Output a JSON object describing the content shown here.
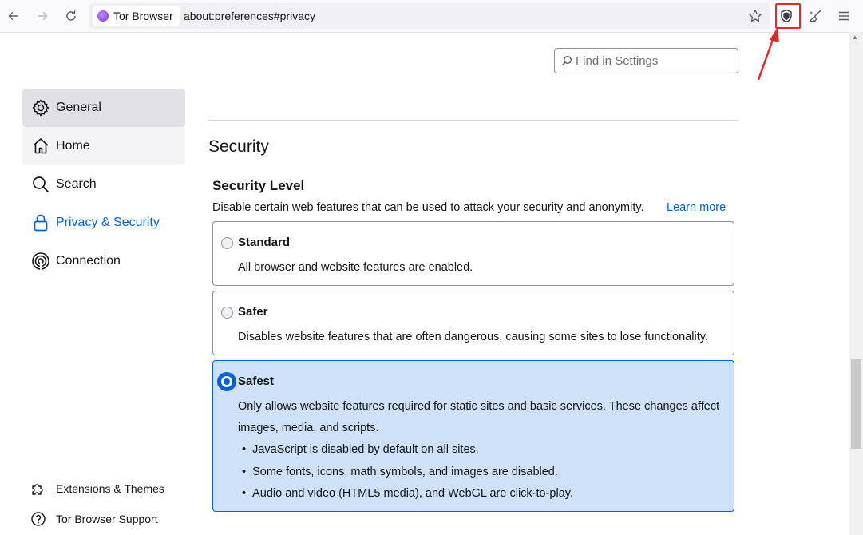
{
  "browser": {
    "identity_label": "Tor Browser",
    "url": "about:preferences#privacy"
  },
  "search": {
    "placeholder": "Find in Settings"
  },
  "sidebar": {
    "items": [
      {
        "label": "General"
      },
      {
        "label": "Home"
      },
      {
        "label": "Search"
      },
      {
        "label": "Privacy & Security"
      },
      {
        "label": "Connection"
      }
    ],
    "footer": [
      {
        "label": "Extensions & Themes"
      },
      {
        "label": "Tor Browser Support"
      }
    ]
  },
  "content": {
    "section_title": "Security",
    "level_title": "Security Level",
    "level_desc": "Disable certain web features that can be used to attack your security and anonymity.",
    "learn_more": "Learn more",
    "options": [
      {
        "title": "Standard",
        "desc": "All browser and website features are enabled.",
        "selected": false
      },
      {
        "title": "Safer",
        "desc": "Disables website features that are often dangerous, causing some sites to lose functionality.",
        "selected": false
      },
      {
        "title": "Safest",
        "desc": "Only allows website features required for static sites and basic services. These changes affect images, media, and scripts.",
        "selected": true,
        "bullets": [
          "JavaScript is disabled by default on all sites.",
          "Some fonts, icons, math symbols, and images are disabled.",
          "Audio and video (HTML5 media), and WebGL are click-to-play."
        ]
      }
    ]
  },
  "colors": {
    "accent": "#0061e0",
    "selected_bg": "#cfe1f8",
    "annotation": "#e22a2a"
  }
}
